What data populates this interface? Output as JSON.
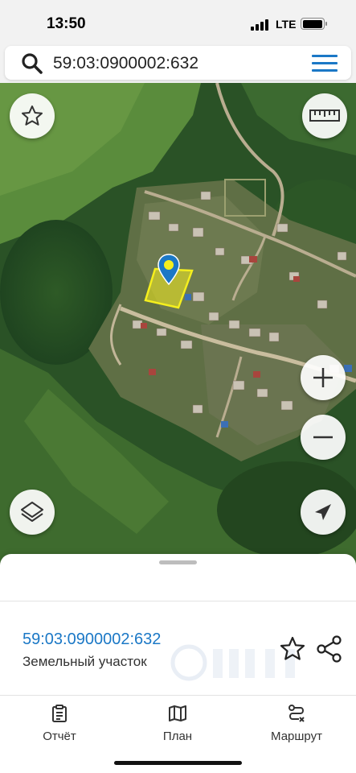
{
  "status_bar": {
    "time": "13:50",
    "network": "LTE",
    "battery_level": 0.9
  },
  "search": {
    "query": "59:03:0900002:632",
    "search_icon": "search-icon",
    "menu_icon": "hamburger-menu-icon"
  },
  "map": {
    "buttons": {
      "favorite_icon": "star-icon",
      "ruler_icon": "ruler-icon",
      "zoom_in_icon": "plus-icon",
      "zoom_out_icon": "minus-icon",
      "layers_icon": "layers-icon",
      "locate_icon": "navigation-arrow-icon"
    },
    "parcel_highlight_color": "#f5ef1e",
    "marker_color": "#1b78c6"
  },
  "sheet": {
    "cadastral_number": "59:03:0900002:632",
    "object_type": "Земельный участок",
    "favorite_icon": "star-icon",
    "share_icon": "share-icon",
    "watermark_logo": "циан"
  },
  "tabs": [
    {
      "label": "Отчёт",
      "icon": "clipboard-icon"
    },
    {
      "label": "План",
      "icon": "map-plan-icon"
    },
    {
      "label": "Маршрут",
      "icon": "route-icon"
    }
  ]
}
